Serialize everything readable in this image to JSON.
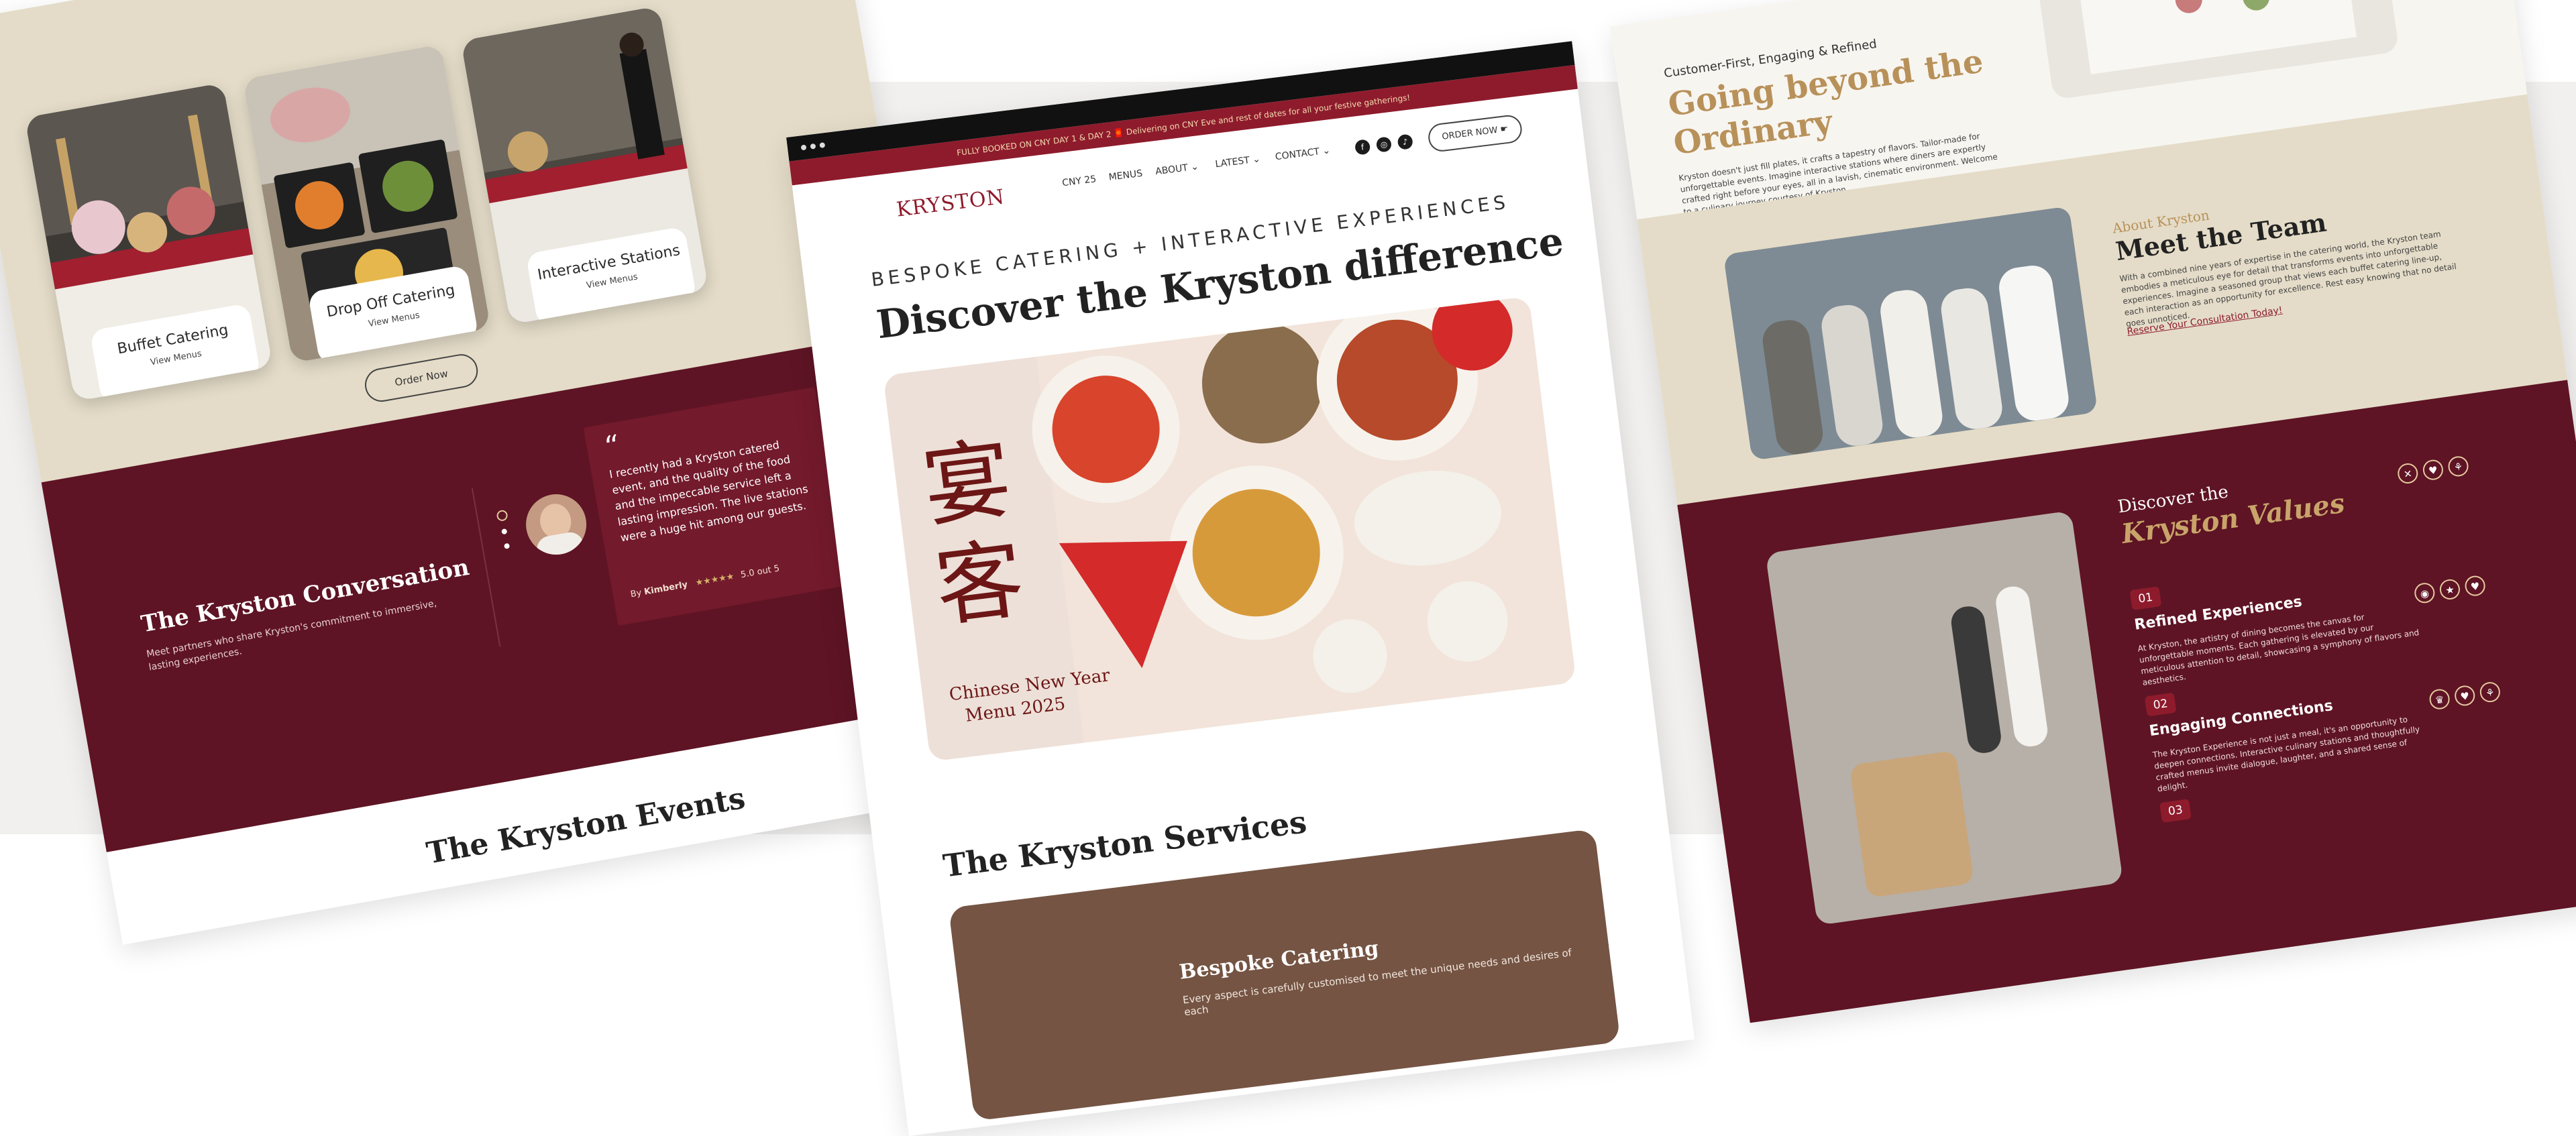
{
  "left": {
    "services": [
      {
        "title": "Buffet Catering",
        "link": "View Menus"
      },
      {
        "title": "Drop Off Catering",
        "link": "View Menus"
      },
      {
        "title": "Interactive Stations",
        "link": "View Menus"
      }
    ],
    "order_button": "Order Now",
    "conversation": {
      "title": "The Kryston Conversation",
      "subtitle": "Meet partners who share Kryston's commitment to immersive, lasting experiences.",
      "quote_mark": "“",
      "quote": "I recently had a Kryston catered event, and the quality of the food and the impeccable service left a lasting impression. The live stations were a huge hit among our guests.",
      "by": "By",
      "author": "Kimberly",
      "rating": "5.0 out 5"
    },
    "events_title": "The Kryston Events"
  },
  "center": {
    "promo": "FULLY BOOKED ON CNY DAY 1 & DAY 2 🧧 Delivering on CNY Eve and rest of dates for all your festive gatherings!",
    "logo": "KRYSTON",
    "nav": [
      "CNY 25",
      "MENUS",
      "ABOUT",
      "LATEST",
      "CONTACT"
    ],
    "social": {
      "facebook": "f",
      "instagram": "◎",
      "tiktok": "♪"
    },
    "order_button": "ORDER NOW",
    "hero_tag": "BESPOKE CATERING + INTERACTIVE EXPERIENCES",
    "hero_title": "Discover the Kryston difference",
    "hero_image": {
      "chinese_chars": "宴客",
      "caption_1": "Chinese New Year",
      "caption_2": "Menu 2025"
    },
    "services_title": "The Kryston Services",
    "service_card": {
      "title": "Bespoke Catering",
      "desc": "Every aspect is carefully customised to meet the unique needs and desires of each"
    }
  },
  "right": {
    "eyebrow": "Customer-First, Engaging & Refined",
    "title_1": "Going beyond the",
    "title_2": "Ordinary",
    "intro": "Kryston doesn't just fill plates, it crafts a tapestry of flavors. Tailor-made for unforgettable events. Imagine interactive stations where diners are expertly crafted right before your eyes, all in a lavish, cinematic environment. Welcome to a culinary journey courtesy of Kryston.",
    "about_eyebrow": "About Kryston",
    "about_title": "Meet the Team",
    "about_text": "With a combined nine years of expertise in the catering world, the Kryston team embodies a meticulous eye for detail that transforms events into unforgettable experiences. Imagine a seasoned group that views each buffet catering line-up, each interaction as an opportunity for excellence. Rest easy knowing that no detail goes unnoticed.",
    "about_link": "Reserve Your Consultation Today!",
    "values_eyebrow": "Discover the",
    "values_title": "Kryston Values",
    "values": [
      {
        "num": "01",
        "title": "Refined Experiences",
        "text": "At Kryston, the artistry of dining becomes the canvas for unforgettable moments. Each gathering is elevated by our meticulous attention to detail, showcasing a symphony of flavors and aesthetics."
      },
      {
        "num": "02",
        "title": "Engaging Connections",
        "text": "The Kryston Experience is not just a meal, it's an opportunity to deepen connections. Interactive culinary stations and thoughtfully crafted menus invite dialogue, laughter, and a shared sense of delight."
      },
      {
        "num": "03",
        "title": "",
        "text": ""
      }
    ],
    "value_icons": [
      [
        "✕",
        "♥",
        "⚘"
      ],
      [
        "◉",
        "★",
        "♥"
      ],
      [
        "♛",
        "♥",
        "⚘"
      ]
    ],
    "colors": {
      "burgundy": "#5e1424",
      "gold": "#b8915a",
      "tan": "#e4dcc8"
    }
  }
}
